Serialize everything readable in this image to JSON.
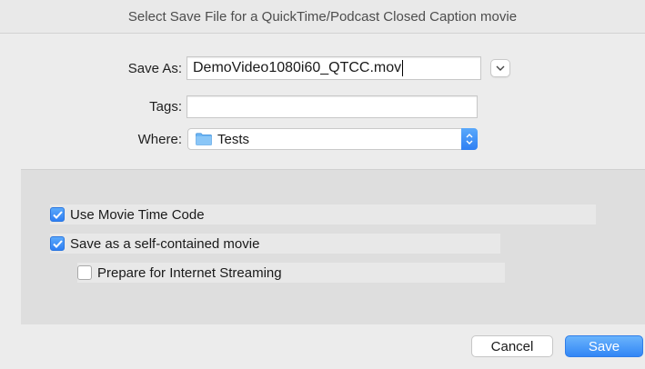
{
  "window": {
    "title": "Select Save File for a QuickTime/Podcast Closed Caption movie"
  },
  "form": {
    "save_as_label": "Save As:",
    "save_as_value": "DemoVideo1080i60_QTCC.mov",
    "tags_label": "Tags:",
    "tags_value": "",
    "where_label": "Where:",
    "where_value": "Tests"
  },
  "options": [
    {
      "label": "Use Movie Time Code",
      "checked": true
    },
    {
      "label": "Save as a self-contained movie",
      "checked": true
    },
    {
      "label": "Prepare for Internet Streaming",
      "checked": false
    }
  ],
  "buttons": {
    "cancel": "Cancel",
    "save": "Save"
  },
  "colors": {
    "accent": "#2f7ff3",
    "dialog_bg": "#ececec",
    "options_bg": "#dedede"
  },
  "icons": {
    "expand": "chevron-down-icon",
    "folder": "folder-icon",
    "stepper": "up-down-chevron-icon",
    "check": "checkmark-icon"
  }
}
